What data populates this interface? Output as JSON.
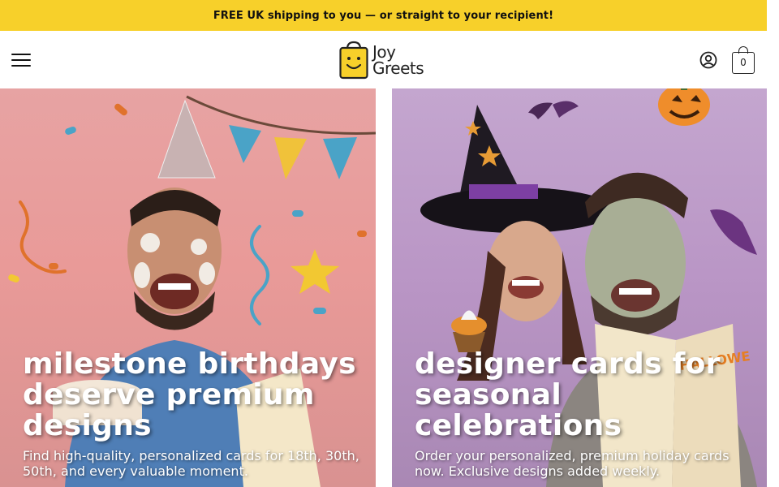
{
  "promo_bar": {
    "text": "FREE UK shipping to you — or straight to your recipient!",
    "background": "#f7d02a"
  },
  "header": {
    "menu_icon": "hamburger-menu-icon",
    "logo": {
      "line1": "Joy",
      "line2": "Greets",
      "brand_color": "#f7d02a"
    },
    "account_icon": "user-account-icon",
    "cart": {
      "icon": "shopping-bag-icon",
      "count": "0"
    }
  },
  "hero_cards": [
    {
      "title": "milestone birthdays deserve premium designs",
      "subtitle": "Find high-quality, personalized cards for 18th, 30th, 50th, and every valuable moment.",
      "image_alt": "Man with cake on face wearing party hat holding birthday card"
    },
    {
      "title": "designer cards for seasonal celebrations",
      "subtitle": "Order your personalized, premium holiday cards now. Exclusive designs added weekly.",
      "image_alt": "Couple in Halloween costumes holding a Happy Halloween card"
    }
  ]
}
